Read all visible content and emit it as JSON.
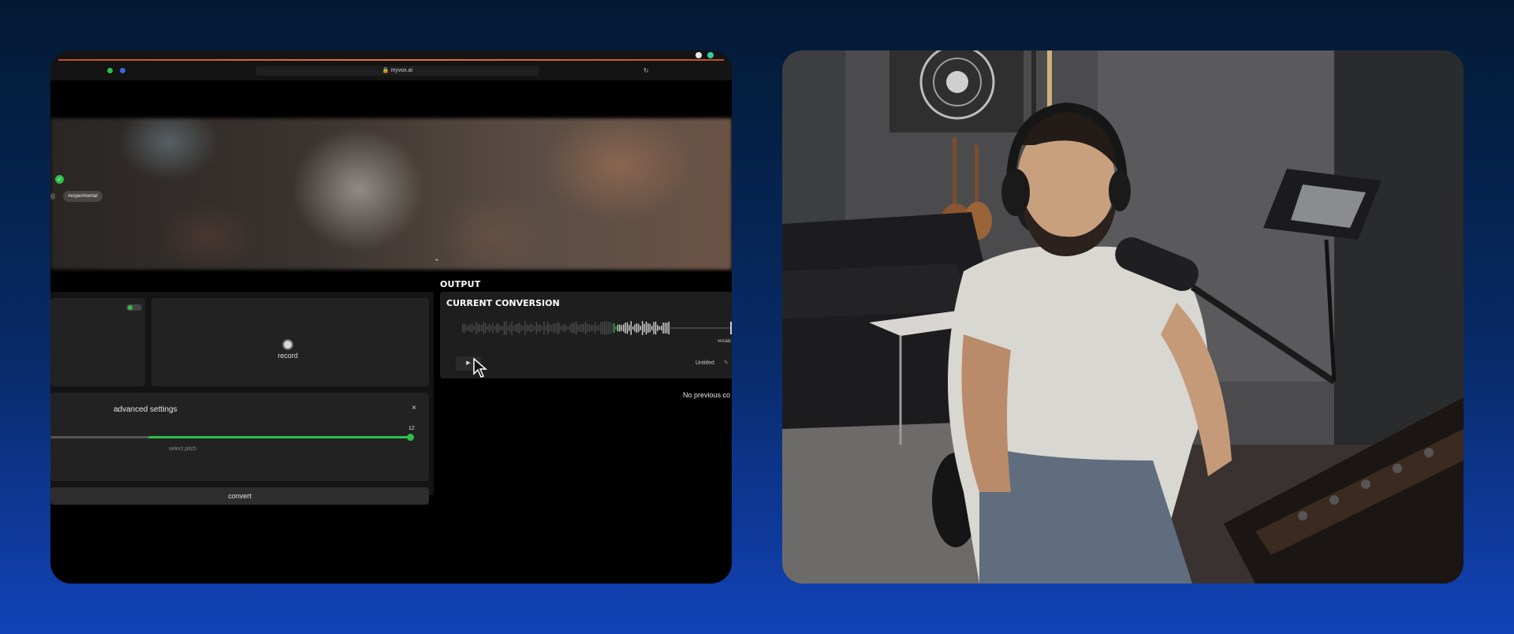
{
  "browser": {
    "url": "myvox.ai"
  },
  "hero": {
    "tag": "#experimental"
  },
  "record": {
    "label": "record"
  },
  "advanced": {
    "title": "advanced settings",
    "close": "×",
    "pitch_value": "12",
    "pitch_label": "select pitch",
    "pitch_fraction": 1.0
  },
  "convert": {
    "label": "convert"
  },
  "output": {
    "heading": "OUTPUT",
    "card_title": "CURRENT CONVERSION",
    "track_label": "vocals",
    "file_name": "Untitled",
    "empty_message": "No previous co"
  },
  "colors": {
    "accent": "#2fbf4a",
    "background_top": "#031a33",
    "background_bottom": "#1242b8"
  },
  "icons": [
    "lock-icon",
    "reload-icon",
    "check-icon",
    "chevron-up-icon",
    "record-icon",
    "close-icon",
    "play-icon",
    "pencil-icon",
    "mouse-cursor-icon"
  ]
}
